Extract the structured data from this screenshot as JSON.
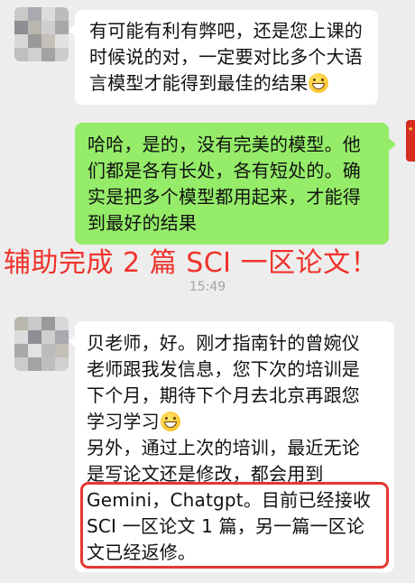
{
  "messages": [
    {
      "side": "left",
      "lines": [
        "有可能有利有弊吧，还是您上课的",
        "时候说的对，一定要对比多个大语",
        "言模型才能得到最佳的结果"
      ],
      "trailing_emoji": "grinning-face"
    },
    {
      "side": "right",
      "lines": [
        "哈哈，是的，没有完美的模型。他",
        "们都是各有长处，各有短处的。确",
        "实是把多个模型都用起来，才能得",
        "到最好的结果"
      ]
    },
    {
      "side": "left",
      "lines": [
        "贝老师，好。刚才指南针的曾婉仪",
        "老师跟我发信息，您下次的培训是",
        "下个月，期待下个月去北京再跟您",
        "学习学习",
        "另外，通过上次的培训，最近无论",
        "是写论文还是修改，都会用到",
        "Gemini，Chatgpt。目前已经接收",
        "SCI 一区论文 1 篇，另一篇一区论",
        "文已经返修。"
      ],
      "emoji_after_line": 4
    }
  ],
  "overlay_text": "辅助完成 2 篇 SCI 一区论文！",
  "timestamp": "15:49",
  "colors": {
    "background": "#ededed",
    "incoming_bubble": "#ffffff",
    "outgoing_bubble": "#95ec69",
    "overlay_text": "#f0322b",
    "highlight_border": "#e5372f",
    "timestamp": "#a3a3a3"
  }
}
